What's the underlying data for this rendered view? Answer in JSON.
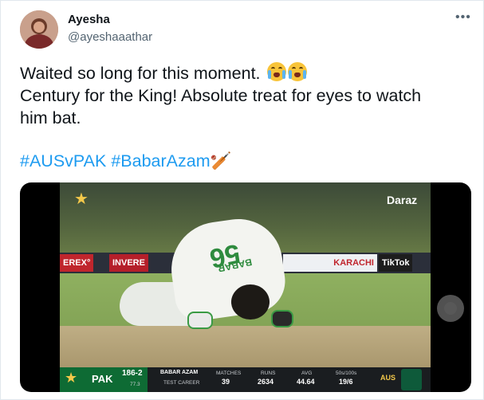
{
  "user": {
    "name": "Ayesha",
    "handle": "@ayeshaaathar"
  },
  "more_icon": "more-horizontal-icon",
  "tweet": {
    "line1": "Waited so long for this moment.",
    "line2": "Century for the King! Absolute treat for eyes to watch",
    "line3": "him bat.",
    "emoji": "crying-face-icon"
  },
  "hashtags": [
    "#AUSvPAK",
    "#BabarAzam🏏"
  ],
  "media": {
    "type": "video",
    "brand": "Daraz",
    "boards": [
      "EREX°",
      "INVERE",
      "KARACHI",
      "TikTok"
    ],
    "jersey_number": "56",
    "jersey_name": "BABAR",
    "scorecard": {
      "team": "PAK",
      "score": "186-2",
      "overs": "77.3",
      "player": "BABAR AZAM",
      "player_sub": "TEST CAREER",
      "matches_label": "MATCHES",
      "matches": "39",
      "runs_label": "RUNS",
      "runs": "2634",
      "avg_label": "AVG",
      "avg": "44.64",
      "fifties_label": "50s/100s",
      "fifties": "19/6",
      "opponent": "AUS"
    }
  }
}
